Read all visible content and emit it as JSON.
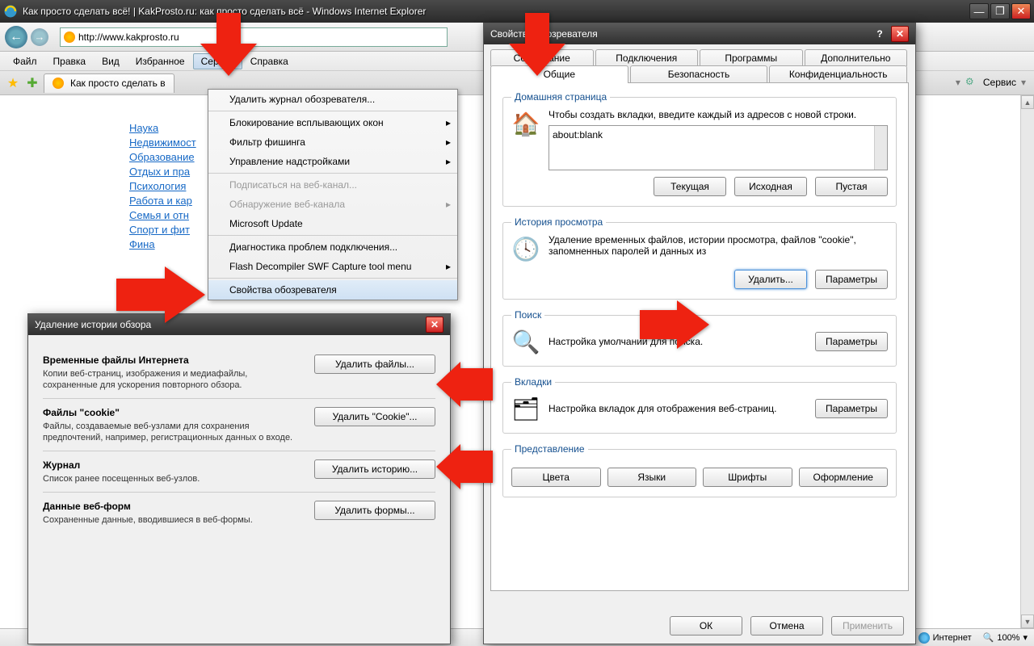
{
  "window": {
    "title": "Как просто сделать всё! | KakProsto.ru: как просто сделать всё - Windows Internet Explorer"
  },
  "nav": {
    "url": "http://www.kakprosto.ru"
  },
  "menubar": [
    "Файл",
    "Правка",
    "Вид",
    "Избранное",
    "Сервис",
    "Справка"
  ],
  "tab": {
    "label": "Как просто сделать в"
  },
  "toolsRight": {
    "label": "Сервис"
  },
  "dropdown": {
    "items": [
      {
        "label": "Удалить журнал обозревателя...",
        "sub": false
      },
      {
        "sep": true
      },
      {
        "label": "Блокирование всплывающих окон",
        "sub": true
      },
      {
        "label": "Фильтр фишинга",
        "sub": true
      },
      {
        "label": "Управление надстройками",
        "sub": true
      },
      {
        "sep": true
      },
      {
        "label": "Подписаться на веб-канал...",
        "disabled": true
      },
      {
        "label": "Обнаружение веб-канала",
        "sub": true,
        "disabled": true
      },
      {
        "label": "Microsoft Update"
      },
      {
        "sep": true
      },
      {
        "label": "Диагностика проблем подключения..."
      },
      {
        "label": "Flash Decompiler SWF Capture tool menu",
        "sub": true
      },
      {
        "sep": true
      },
      {
        "label": "Свойства обозревателя",
        "sel": true
      }
    ]
  },
  "sidebar": [
    "Наука",
    "Недвижимост",
    "Образование",
    "Отдых и пра",
    "Психология",
    "Работа и кар",
    "Семья и отн",
    "Спорт и фит",
    "Фина"
  ],
  "iopt": {
    "title": "Свойства обозревателя",
    "tabsRow1": [
      "Содержание",
      "Подключения",
      "Программы",
      "Дополнительно"
    ],
    "tabsRow2": [
      "Общие",
      "Безопасность",
      "Конфиденциальность"
    ],
    "homepage": {
      "legend": "Домашняя страница",
      "text": "Чтобы создать вкладки, введите каждый из адресов с новой строки.",
      "value": "about:blank",
      "btns": [
        "Текущая",
        "Исходная",
        "Пустая"
      ]
    },
    "history": {
      "legend": "История просмотра",
      "text": "Удаление временных файлов, истории просмотра, файлов \"cookie\", запомненных паролей и данных из",
      "btns": [
        "Удалить...",
        "Параметры"
      ]
    },
    "search": {
      "legend": "Поиск",
      "text": "Настройка умолчаний для поиска.",
      "btn": "Параметры"
    },
    "tabsSect": {
      "legend": "Вкладки",
      "text": "Настройка вкладок для отображения веб-страниц.",
      "btn": "Параметры"
    },
    "appearance": {
      "legend": "Представление",
      "btns": [
        "Цвета",
        "Языки",
        "Шрифты",
        "Оформление"
      ]
    },
    "footer": [
      "ОК",
      "Отмена",
      "Применить"
    ]
  },
  "delhist": {
    "title": "Удаление истории обзора",
    "rows": [
      {
        "h": "Временные файлы Интернета",
        "d": "Копии веб-страниц, изображения и медиафайлы, сохраненные для ускорения повторного обзора.",
        "b": "Удалить файлы..."
      },
      {
        "h": "Файлы \"cookie\"",
        "d": "Файлы, создаваемые веб-узлами для сохранения предпочтений, например, регистрационных данных о входе.",
        "b": "Удалить \"Cookie\"..."
      },
      {
        "h": "Журнал",
        "d": "Список ранее посещенных веб-узлов.",
        "b": "Удалить историю..."
      },
      {
        "h": "Данные веб-форм",
        "d": "Сохраненные данные, вводившиеся в веб-формы.",
        "b": "Удалить формы..."
      }
    ]
  },
  "status": {
    "zone": "Интернет",
    "zoom": "100%"
  }
}
